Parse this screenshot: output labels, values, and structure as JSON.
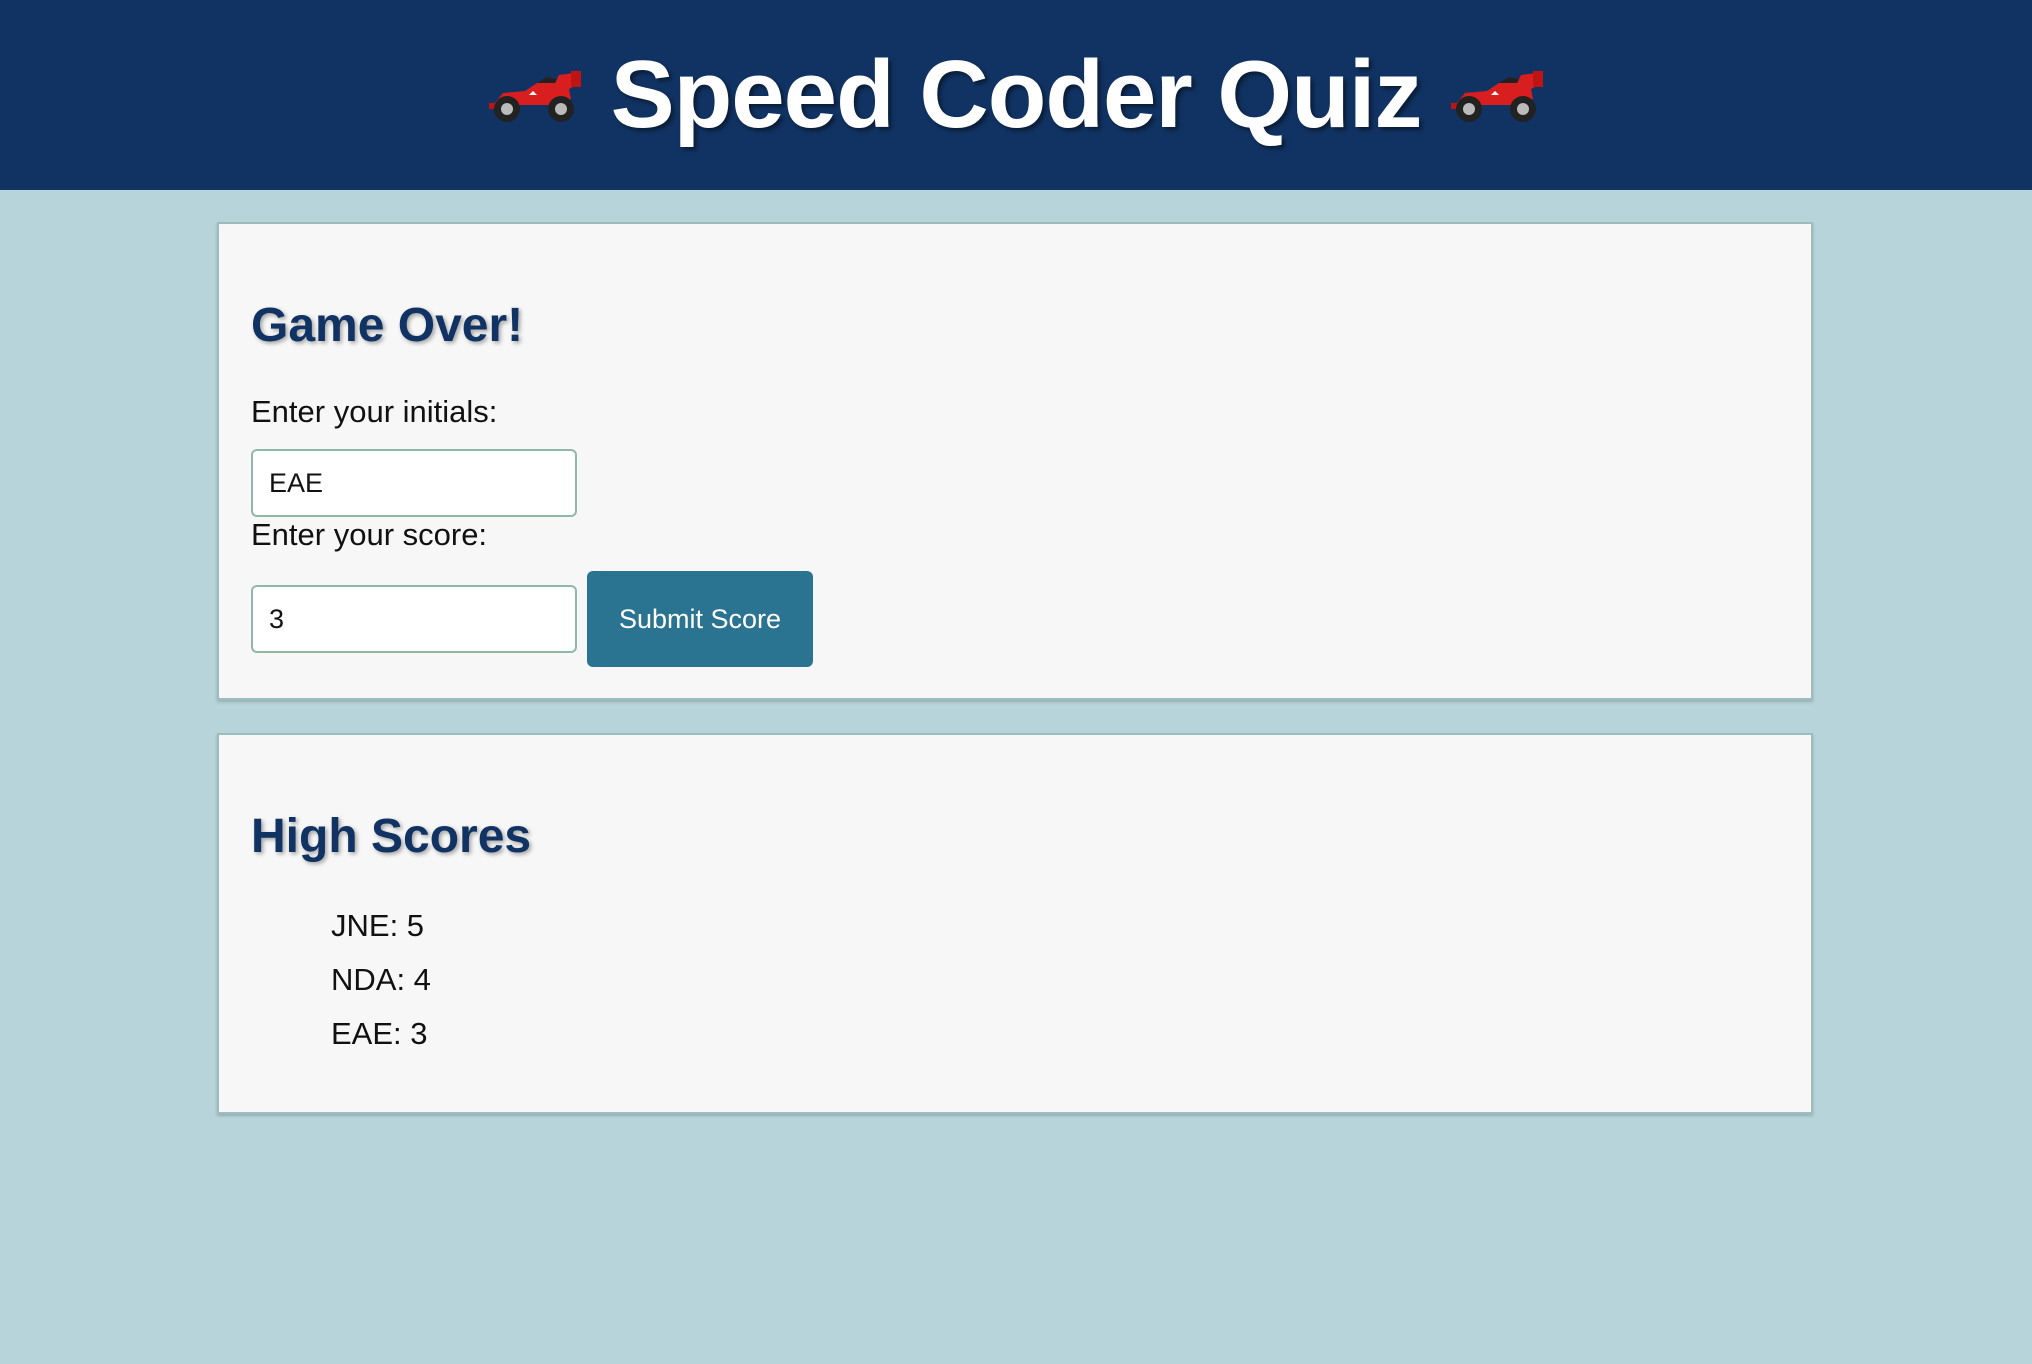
{
  "header": {
    "title": "Speed Coder Quiz",
    "left_icon": "race-car-icon",
    "right_icon": "race-car-icon"
  },
  "game_over": {
    "heading": "Game Over!",
    "initials_label": "Enter your initials:",
    "initials_value": "EAE",
    "score_label": "Enter your score:",
    "score_value": "3",
    "submit_label": "Submit Score"
  },
  "high_scores": {
    "heading": "High Scores",
    "items": [
      {
        "text": "JNE: 5"
      },
      {
        "text": "NDA: 4"
      },
      {
        "text": "EAE: 3"
      }
    ]
  },
  "colors": {
    "header_bg": "#113363",
    "page_bg": "#b6d4da",
    "card_bg": "#f7f7f7",
    "heading": "#113363",
    "button_bg": "#2a7391"
  }
}
